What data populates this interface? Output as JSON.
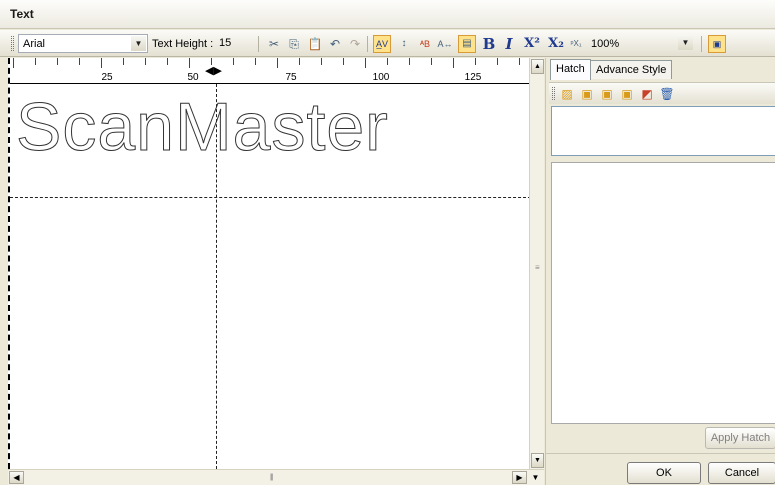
{
  "window": {
    "title": "Text"
  },
  "toolbar": {
    "font": "Arial",
    "text_height_label": "Text Height :",
    "text_height_value": "15",
    "bold_label": "B",
    "italic_label": "I",
    "superscript_label": "X²",
    "subscript_label": "X₂",
    "zoom": "100%",
    "icons": [
      "cut-icon",
      "copy-icon",
      "paste-icon",
      "undo-icon",
      "redo-icon",
      "char-spacing-icon",
      "line-spacing-icon",
      "text-arc-icon",
      "char-width-icon",
      "align-icon",
      "special-script-icon",
      "hatch-toggle-icon"
    ]
  },
  "ruler": {
    "labels": [
      "25",
      "50",
      "75",
      "100",
      "125"
    ]
  },
  "editor": {
    "content": "ScanMaster"
  },
  "panel": {
    "tabs": [
      {
        "label": "Hatch"
      },
      {
        "label": "Advance Style"
      }
    ],
    "icons": [
      "hatch-pattern-icon",
      "hatch-style-1-icon",
      "hatch-style-2-icon",
      "hatch-style-3-icon",
      "hatch-color-icon",
      "delete-icon"
    ],
    "apply_label": "Apply Hatch",
    "ok_label": "OK",
    "cancel_label": "Cancel"
  }
}
